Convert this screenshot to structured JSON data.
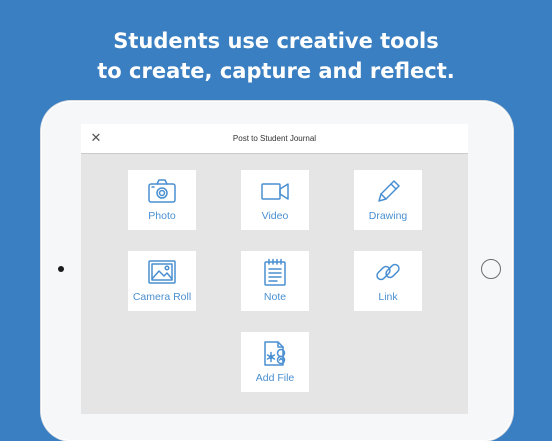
{
  "headline": {
    "line1": "Students use creative tools",
    "line2": "to create, capture and reflect."
  },
  "accent_color": "#4a8fd1",
  "background_color": "#3a7fc1",
  "modal": {
    "title": "Post to Student Journal",
    "close_icon": "close-icon"
  },
  "tiles": [
    {
      "label": "Photo",
      "icon": "camera-icon"
    },
    {
      "label": "Video",
      "icon": "video-camera-icon"
    },
    {
      "label": "Drawing",
      "icon": "pencil-icon"
    },
    {
      "label": "Camera Roll",
      "icon": "image-icon"
    },
    {
      "label": "Note",
      "icon": "notepad-icon"
    },
    {
      "label": "Link",
      "icon": "link-icon"
    },
    {
      "label": "Add File",
      "icon": "file-icon"
    }
  ]
}
